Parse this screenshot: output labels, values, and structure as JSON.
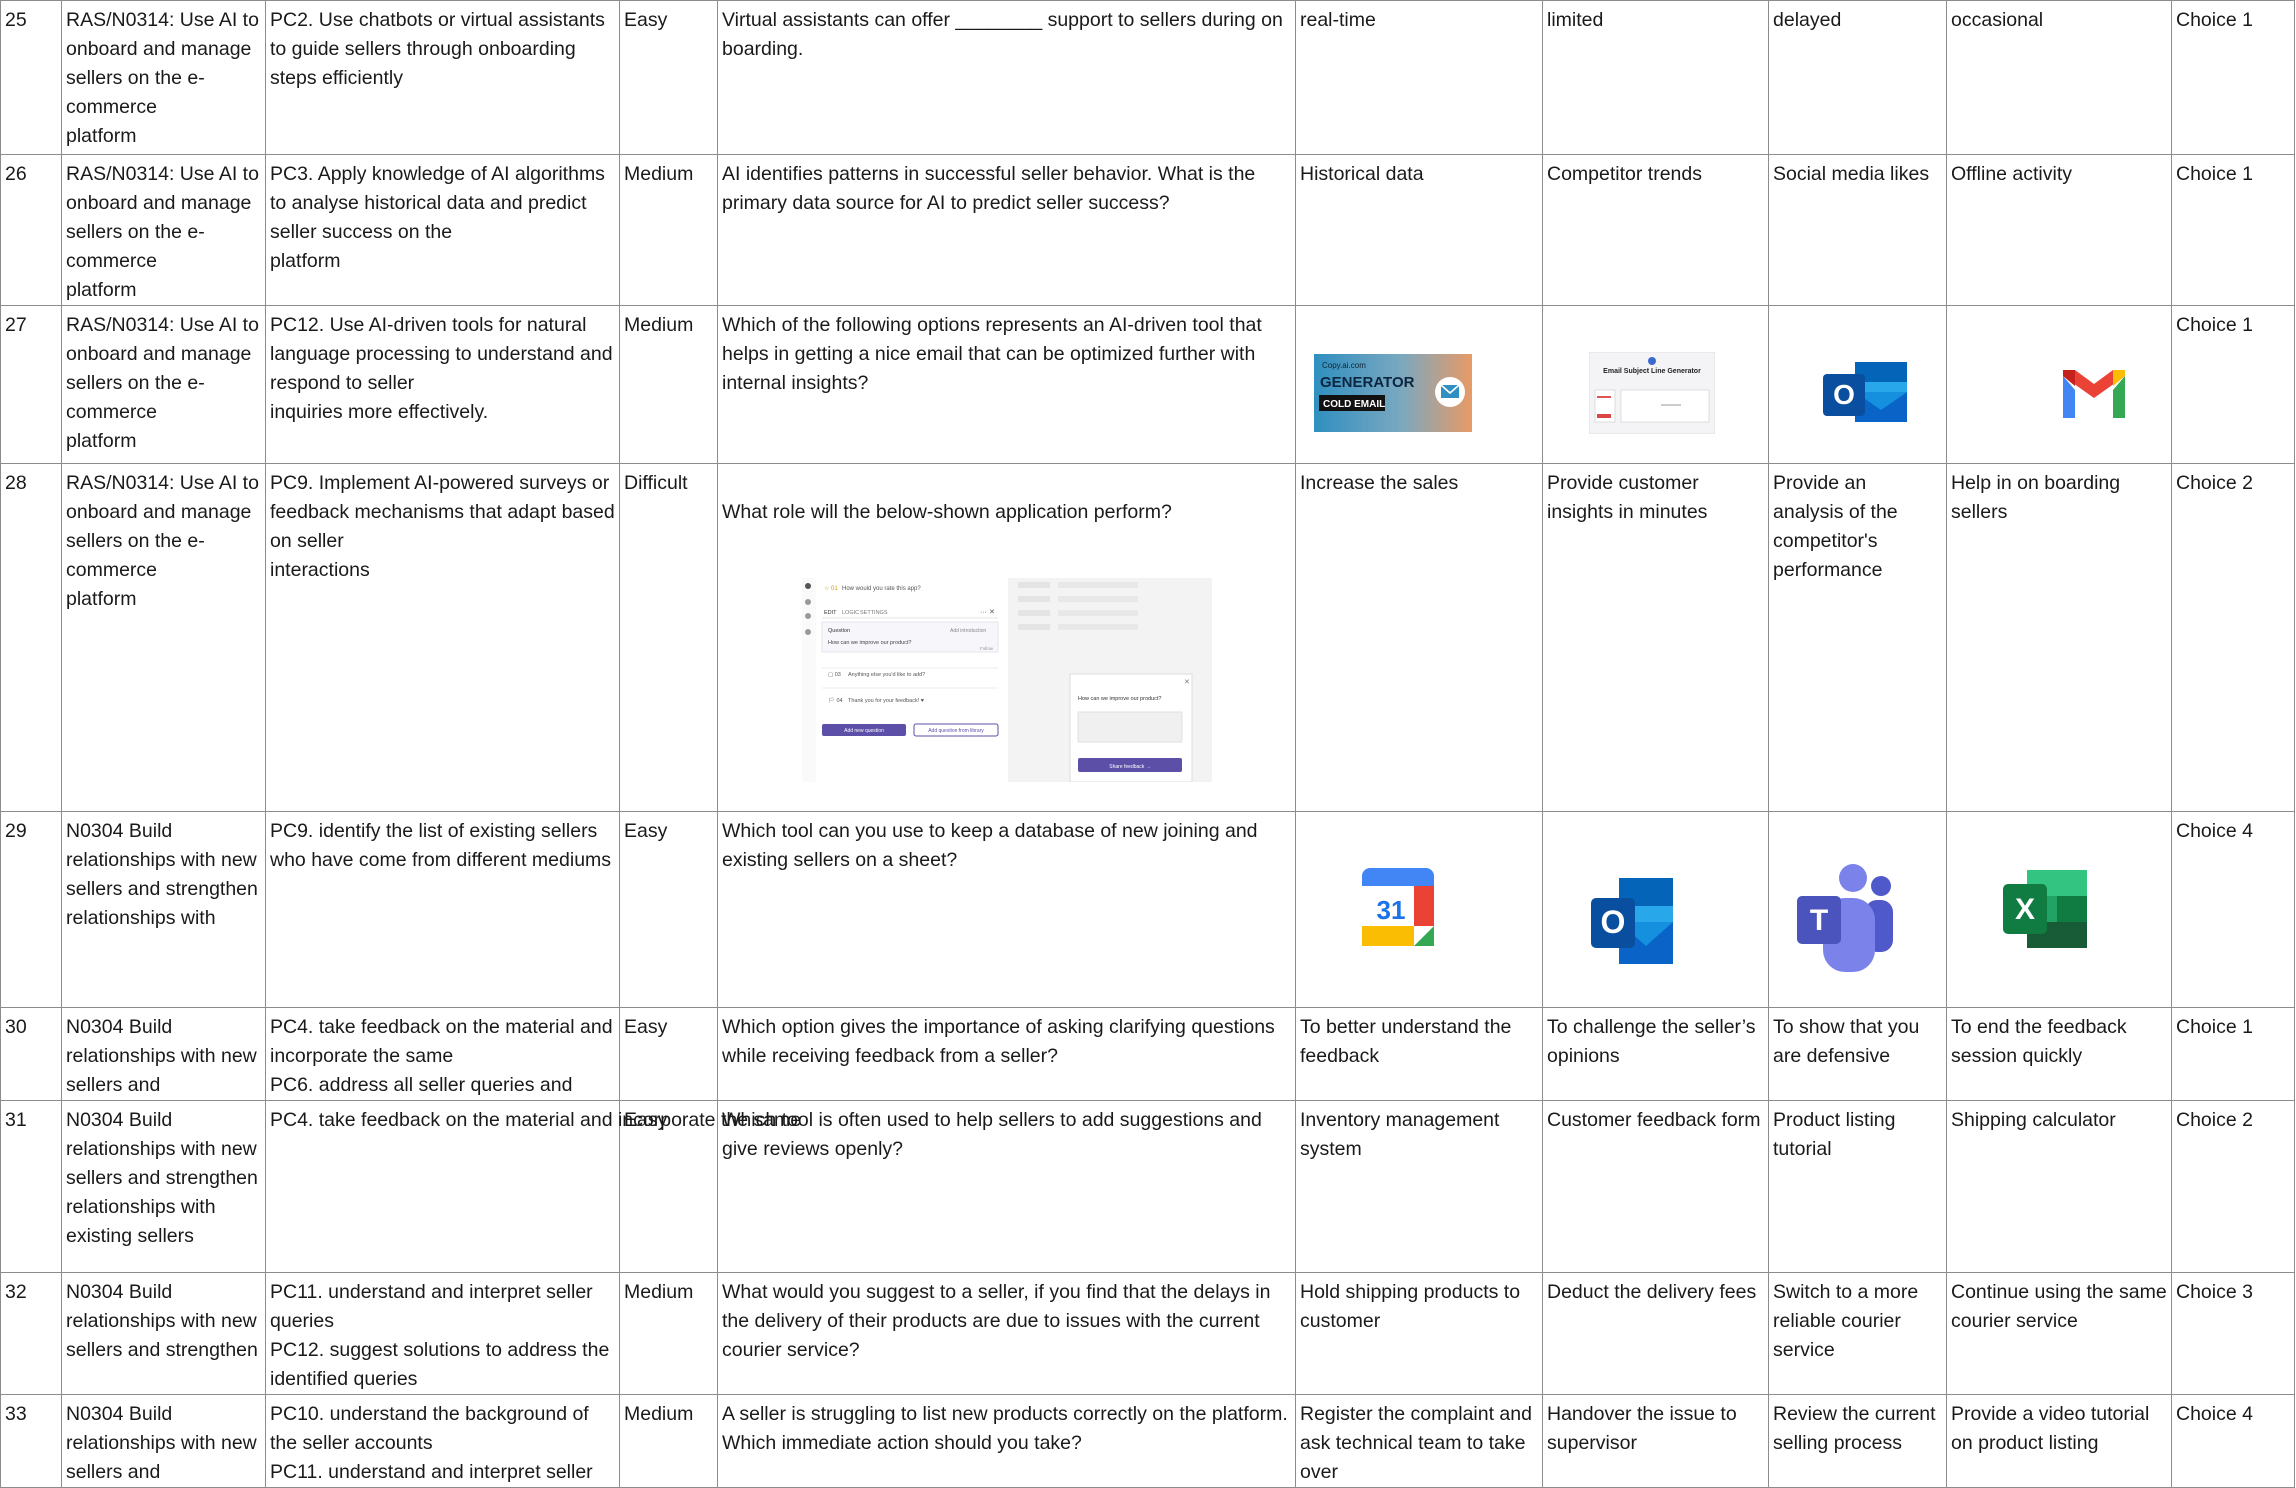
{
  "rows": [
    {
      "no": "25",
      "nos": "RAS/N0314: Use AI to onboard and manage sellers on the e-commerce\nplatform",
      "pc": "PC2. Use chatbots or virtual assistants to guide sellers through onboarding steps efficiently",
      "level": "Easy",
      "question": "Virtual assistants can offer ________ support to sellers during on boarding.",
      "options": [
        "real-time",
        "limited",
        "delayed",
        "occasional"
      ],
      "answer": "Choice 1"
    },
    {
      "no": "26",
      "nos": "RAS/N0314: Use AI to onboard and manage sellers on the e-commerce\nplatform",
      "pc": "PC3. Apply knowledge of AI algorithms to analyse historical data and predict seller success on the\nplatform",
      "level": "Medium",
      "question": "AI identifies patterns in successful seller behavior. What is the primary data source for AI to predict seller success?",
      "options": [
        "Historical data",
        "Competitor trends",
        "Social media likes",
        "Offline activity"
      ],
      "answer": "Choice 1"
    },
    {
      "no": "27",
      "nos": "RAS/N0314: Use AI to onboard and manage sellers on the e-commerce\nplatform",
      "pc": "PC12. Use AI-driven tools for natural language processing to understand and respond to seller\ninquiries more effectively.",
      "level": "Medium",
      "question": "Which of the following options represents an AI-driven tool that helps in getting a nice email that can be optimized further with internal insights?",
      "option_images": [
        {
          "icon": "cold-email-generator-icon",
          "brand": "Copy.ai.com",
          "title": "GENERATOR",
          "tag": "COLD EMAIL"
        },
        {
          "icon": "email-subject-line-generator-icon",
          "title": "Email Subject Line Generator"
        },
        {
          "icon": "outlook-icon",
          "letter": "O"
        },
        {
          "icon": "gmail-icon",
          "letter": "M"
        }
      ],
      "answer": "Choice 1"
    },
    {
      "no": "28",
      "nos": "RAS/N0314: Use AI to onboard and manage sellers on the e-commerce\nplatform",
      "pc": "PC9. Implement AI-powered surveys or feedback mechanisms that adapt based on seller\ninteractions",
      "level": "Difficult",
      "question": "What role will the below-shown application perform?",
      "app_screenshot": {
        "q1": "How would you rate this app?",
        "tabs": [
          "EDIT",
          "LOGIC",
          "SETTINGS"
        ],
        "q2_label": "Question",
        "q2_link": "Add introduction",
        "q2_text": "How can we improve our product?",
        "q2_hint": "Follow",
        "q3": "Anything else you'd like to add?",
        "q4": "Thank you for your feedback! ♥",
        "btn_add": "Add new question",
        "btn_library": "Add question from library",
        "preview_q": "How can we improve our product?",
        "preview_btn": "Share feedback →"
      },
      "options": [
        "Increase the sales",
        "Provide customer insights in minutes",
        "Provide an analysis of the competitor's performance",
        "Help in on boarding sellers"
      ],
      "answer": "Choice 2"
    },
    {
      "no": "29",
      "nos": "N0304 Build relationships with new sellers and strengthen relationships with",
      "pc": "PC9. identify the list of existing sellers who have come from different mediums",
      "level": "Easy",
      "question": "Which tool can you use to keep a database of new joining and existing sellers on a sheet?",
      "option_images": [
        {
          "icon": "google-calendar-icon",
          "letter": "31"
        },
        {
          "icon": "outlook-icon",
          "letter": "O"
        },
        {
          "icon": "teams-icon",
          "letter": "T"
        },
        {
          "icon": "excel-icon",
          "letter": "X"
        }
      ],
      "answer": "Choice 4"
    },
    {
      "no": "30",
      "nos": "N0304 Build relationships with new sellers and",
      "pc": "PC4. take feedback on the material and incorporate the same\nPC6. address all seller queries and",
      "level": "Easy",
      "question": "Which option gives the importance of asking clarifying questions while receiving feedback from a seller?",
      "options": [
        "To better understand the feedback",
        "To challenge the seller’s opinions",
        "To show that you are defensive",
        "To end the feedback session quickly"
      ],
      "answer": "Choice 1"
    },
    {
      "no": "31",
      "nos": "N0304 Build relationships with new sellers and strengthen relationships with existing sellers",
      "pc": "PC4. take feedback on the material and incorporate the same",
      "level": "Easy",
      "question": "Which tool is often used to help sellers to add suggestions and give reviews openly?",
      "options": [
        "Inventory management system",
        "Customer feedback form",
        "Product listing tutorial",
        "Shipping calculator"
      ],
      "answer": "Choice 2"
    },
    {
      "no": "32",
      "nos": "N0304 Build relationships with new sellers and strengthen",
      "pc": "PC11. understand and interpret seller queries\nPC12. suggest solutions to address the identified queries",
      "level": "Medium",
      "question": "What would you suggest to a seller, if you find that the delays in the delivery of their products are due to issues with the current courier service?",
      "options": [
        "Hold shipping products to customer",
        "Deduct the delivery fees",
        "Switch to a more reliable courier service",
        "Continue using the same courier service"
      ],
      "answer": "Choice 3"
    },
    {
      "no": "33",
      "nos": "N0304 Build relationships with new sellers and",
      "pc": "PC10. understand the background of the seller accounts\nPC11. understand and interpret seller",
      "level": "Medium",
      "question": "A seller is struggling to list new products correctly on the platform. Which immediate action should you take?",
      "options": [
        "Register the complaint and ask technical team to take over",
        "Handover the issue to supervisor",
        "Review the current selling process",
        "Provide a video tutorial on product listing"
      ],
      "answer": "Choice 4"
    }
  ],
  "colors": {
    "grid": "#8c8c8c",
    "outlook_blue": "#0a64c8",
    "gmail_red": "#ea4335",
    "excel_green": "#1d7044",
    "teams_purple": "#5a5fc8",
    "calendar_blue": "#4285f4",
    "survey_purple": "#5b4fa8"
  }
}
